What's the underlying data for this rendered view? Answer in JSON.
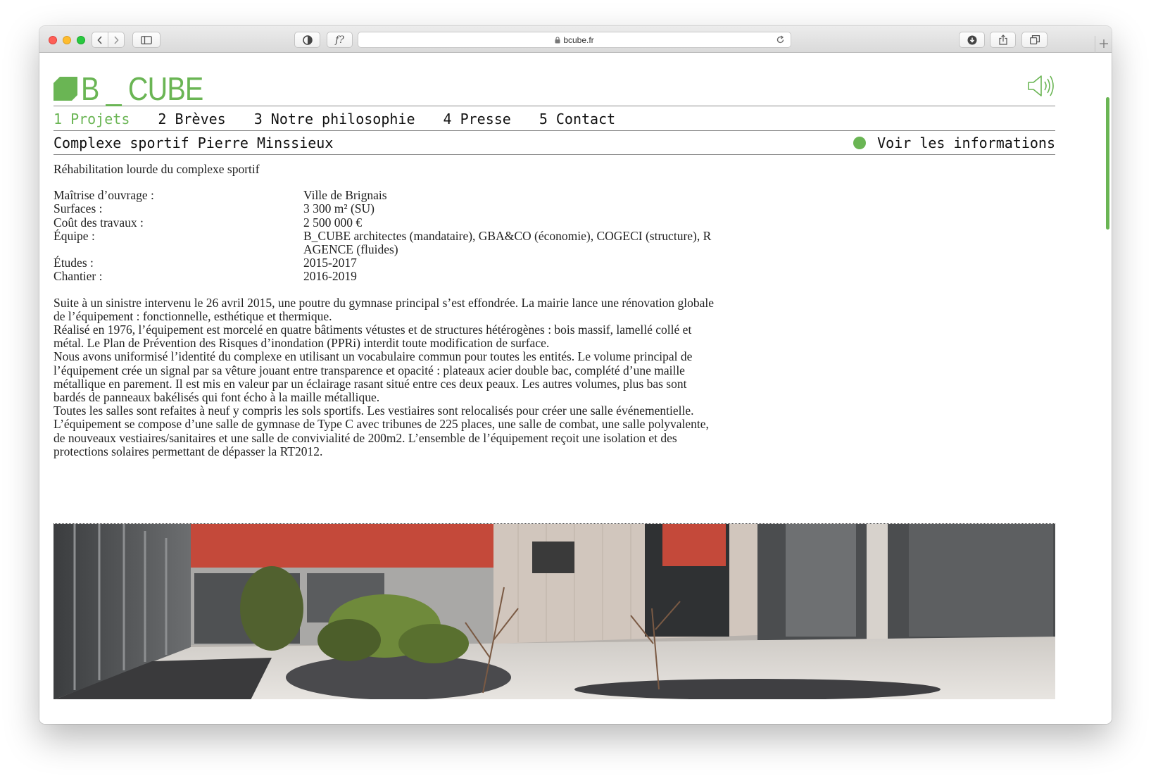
{
  "browser": {
    "url": "bcube.fr",
    "fn_label": "f?"
  },
  "site": {
    "logo_text": "B _ CUBE"
  },
  "nav": {
    "items": [
      {
        "label": "1 Projets",
        "active": true
      },
      {
        "label": "2 Brèves",
        "active": false
      },
      {
        "label": "3 Notre philosophie",
        "active": false
      },
      {
        "label": "4 Presse",
        "active": false
      },
      {
        "label": "5 Contact",
        "active": false
      }
    ]
  },
  "project": {
    "title": "Complexe sportif Pierre Minssieux",
    "info_link": "Voir les informations",
    "subtitle": "Réhabilitation lourde du complexe sportif",
    "facts": [
      {
        "label": "Maîtrise d’ouvrage :",
        "value": "Ville de Brignais"
      },
      {
        "label": "Surfaces :",
        "value": "3 300 m² (SU)"
      },
      {
        "label": "Coût des travaux :",
        "value": "2 500 000 €"
      },
      {
        "label": "Équipe :",
        "value": "B_CUBE architectes (mandataire), GBA&CO (économie), COGECI (structure), R AGENCE (fluides)"
      },
      {
        "label": "Études :",
        "value": "2015-2017"
      },
      {
        "label": "Chantier :",
        "value": "2016-2019"
      }
    ],
    "description": [
      "Suite à un sinistre intervenu le 26 avril 2015, une poutre du gymnase principal s’est effondrée. La mairie lance une rénovation globale de l’équipement : fonctionnelle, esthétique et thermique.",
      "Réalisé en 1976, l’équipement est morcelé en quatre bâtiments vétustes et de structures hétérogènes : bois massif, lamellé collé et métal. Le Plan de Prévention des Risques d’inondation (PPRi) interdit toute modification de surface.",
      "Nous avons uniformisé l’identité du complexe en utilisant un vocabulaire commun pour toutes les entités. Le volume principal de l’équipement crée un signal par sa vêture jouant entre transparence et opacité : plateaux acier double bac, complété d’une maille métallique en parement. Il est mis en valeur par un éclairage rasant situé entre ces deux peaux. Les autres volumes, plus bas sont bardés de panneaux bakélisés qui font écho à la maille métallique.",
      "Toutes les salles sont refaites à neuf y compris les sols sportifs. Les vestiaires sont relocalisés pour créer une salle événementielle.",
      "L’équipement se compose d’une salle de gymnase de Type C avec tribunes de 225 places, une salle de combat, une salle polyvalente, de nouveaux vestiaires/sanitaires et une salle de convivialité de 200m2. L’ensemble de l’équipement reçoit une isolation et des protections solaires permettant de dépasser la RT2012."
    ]
  },
  "colors": {
    "brand_green": "#6ab554",
    "text": "#111111"
  }
}
